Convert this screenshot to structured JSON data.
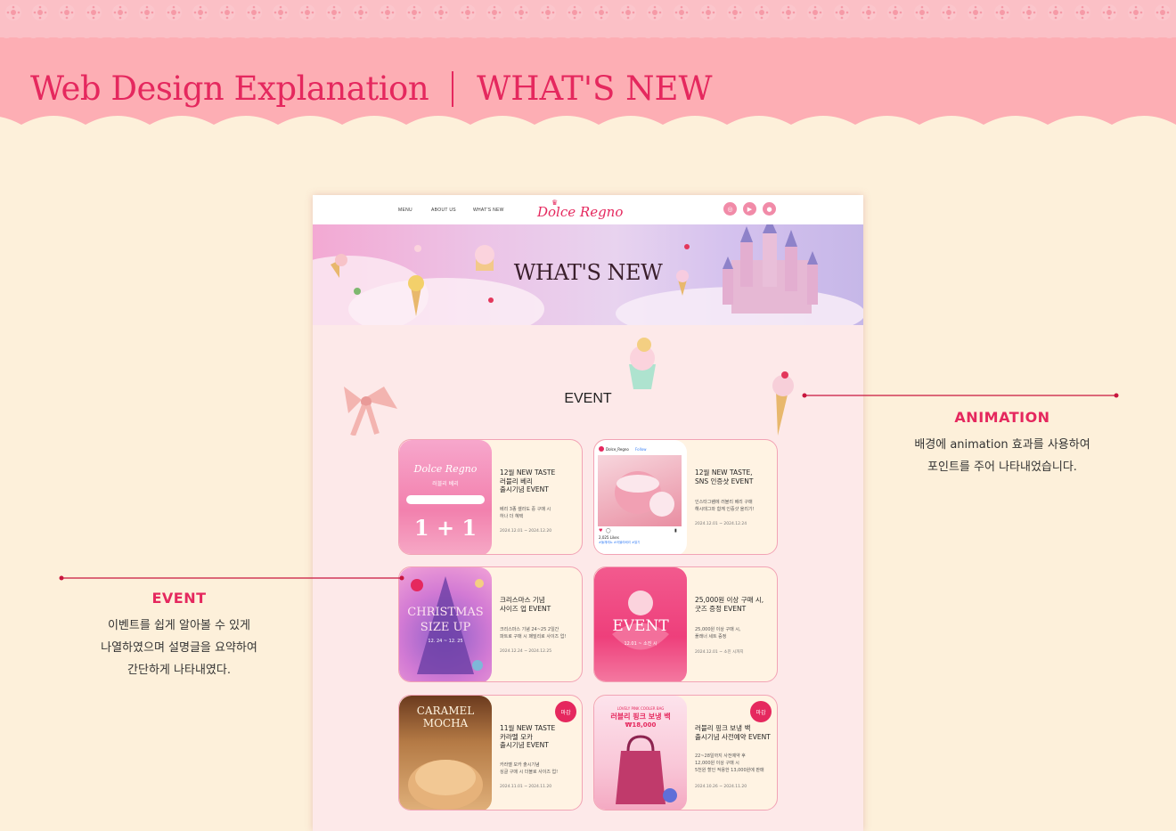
{
  "header": {
    "title": "Web Design Explanation",
    "subtitle": "WHAT'S NEW"
  },
  "mockup": {
    "nav": {
      "links": [
        "MENU",
        "ABOUT US",
        "WHAT'S NEW"
      ],
      "logo": "Dolce Regno",
      "social_icons": [
        "instagram-icon",
        "youtube-icon",
        "talk-icon"
      ]
    },
    "hero_title": "WHAT'S NEW",
    "section_heading": "EVENT",
    "cards": [
      {
        "title": "12월 NEW TASTE\n러블리 베리\n출시기념 EVENT",
        "description": "베리 3종 셀라도 중 구매 시\n하나 더 혜택",
        "date": "2024.12.01 ~ 2024.12.20",
        "image": {
          "brand": "Dolce Regno",
          "headline": "러블리 베리",
          "big_text": "1 + 1"
        },
        "closed": false
      },
      {
        "title": "12월 NEW TASTE,\nSNS 인증샷 EVENT",
        "description": "인스타그램에 러블리 베리 구매\n해시태그와 함께 인증샷 올리기!",
        "date": "2024.12.01 ~ 2024.12.24",
        "image": {
          "account": "Dolce_Regno",
          "follow": "Follow",
          "likes": "2,025 Likes",
          "hashtag": "#돌체레뇨 #러블리베리 #딸기"
        },
        "closed": false
      },
      {
        "title": "크리스마스 기념\n사이즈 업 EVENT",
        "description": "크리스마스 기념 24~25 2일간\n파트로 구매 시 패밀리로 사이즈 업!",
        "date": "2024.12.24 ~ 2024.12.25",
        "image": {
          "big_text": "CHRISTMAS\nSIZE UP",
          "sub": "12. 24 ~ 12. 25"
        },
        "closed": false
      },
      {
        "title": "25,000원 이상 구매 시,\n굿즈 증정 EVENT",
        "description": "25,000원 이상 구매 시,\n플래너 세트 증정",
        "date": "2024.12.01 ~ 소진 시까지",
        "image": {
          "big_text": "EVENT",
          "sub": "12.01 ~ 소진 시"
        },
        "closed": false
      },
      {
        "title": "11월 NEW TASTE\n카라멜 모카\n출시기념 EVENT",
        "description": "카라멜 모카 출시기념\n싱글 구매 시 더블로 사이즈 업!",
        "date": "2024.11.01 ~ 2024.11.20",
        "image": {
          "big_text": "CARAMEL\nMOCHA"
        },
        "closed": true,
        "badge": "마감"
      },
      {
        "title": "러블리 핑크 보냉 백\n출시기념 사전예약 EVENT",
        "description": "22~28일까지 사전예약 후\n12,000원 이상 구매 시\n5천원 할인 적용한 13,000원에 판매",
        "date": "2024.10.26 ~ 2024.11.20",
        "image": {
          "small": "LOVELY PINK COOLER BAG",
          "headline": "러블리 핑크 보냉 백",
          "price": "₩18,000"
        },
        "closed": true,
        "badge": "마감"
      }
    ]
  },
  "annotations": {
    "animation": {
      "title": "ANIMATION",
      "description": "배경에 animation 효과를 사용하여\n포인트를 주어 나타내었습니다."
    },
    "event": {
      "title": "EVENT",
      "description": "이벤트를 쉽게 알아볼 수 있게\n나열하였으며 설명글을 요약하여\n간단하게 나타내였다."
    }
  },
  "colors": {
    "accent": "#e5285e",
    "header_pink": "#fdaeb4",
    "background": "#fdf0da",
    "page_bg": "#fde9e9",
    "card_bg": "#fff3e3"
  }
}
